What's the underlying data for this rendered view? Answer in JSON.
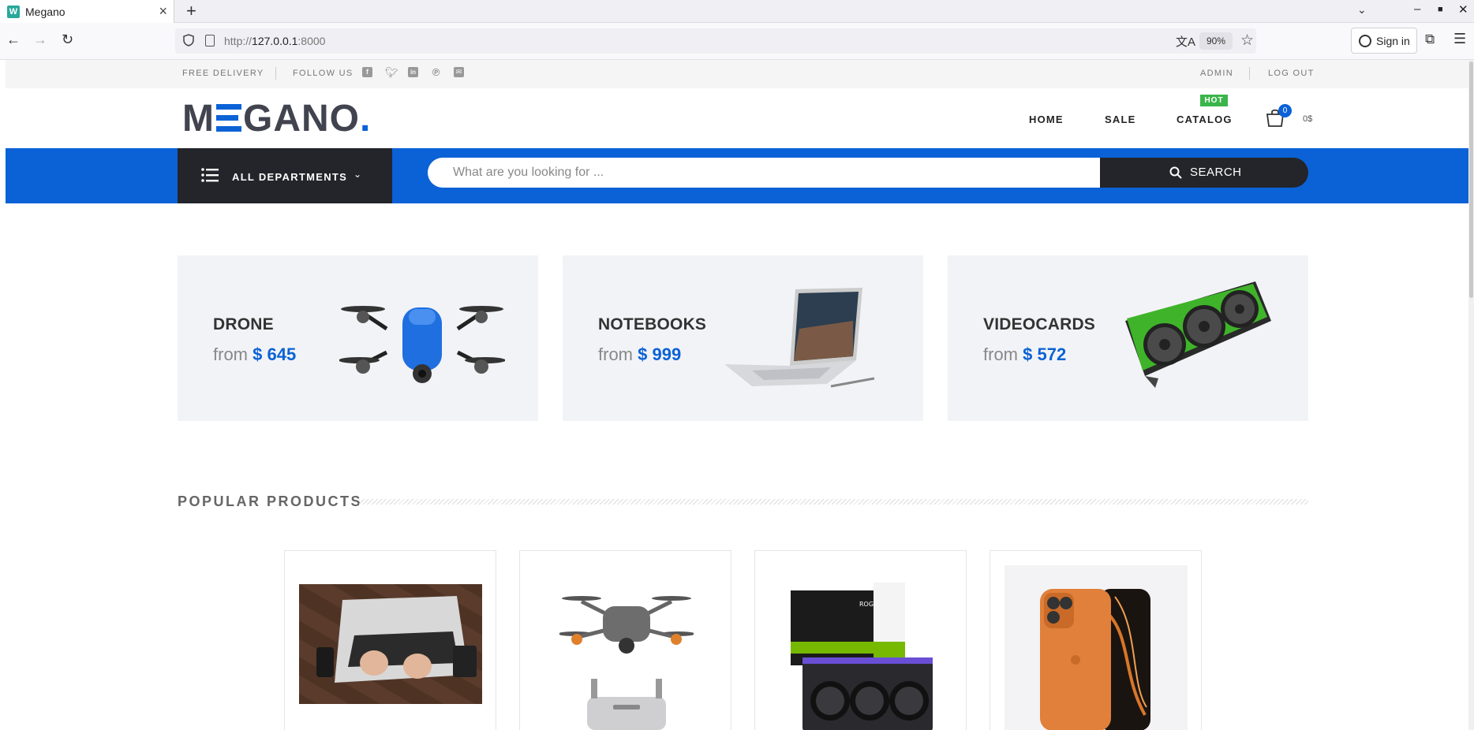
{
  "browser": {
    "tab_title": "Megano",
    "tab_favicon": "W",
    "new_tab_icon": "+",
    "url_prefix": "http://",
    "url_host": "127.0.0.1",
    "url_port": ":8000",
    "zoom": "90%",
    "sign_in_label": "Sign in"
  },
  "topbar": {
    "free_delivery": "FREE DELIVERY",
    "follow_us": "FOLLOW US",
    "social_icons": [
      "facebook-icon",
      "twitter-icon",
      "linkedin-icon",
      "pinterest-icon",
      "mail-icon"
    ],
    "admin": "ADMIN",
    "logout": "LOG OUT"
  },
  "header": {
    "logo_m": "M",
    "logo_rest": "GANO",
    "logo_dot": ".",
    "nav": [
      {
        "label": "HOME"
      },
      {
        "label": "SALE"
      },
      {
        "label": "CATALOG",
        "badge": "HOT"
      }
    ],
    "cart_count": "0",
    "cart_total": "0$"
  },
  "search": {
    "departments_label": "ALL DEPARTMENTS",
    "placeholder": "What are you looking for ...",
    "button_label": "SEARCH"
  },
  "banners": [
    {
      "title": "DRONE",
      "from": "from",
      "price": "$ 645",
      "icon": "drone-image"
    },
    {
      "title": "NOTEBOOKS",
      "from": "from",
      "price": "$ 999",
      "icon": "laptop-image"
    },
    {
      "title": "VIDEOCARDS",
      "from": "from",
      "price": "$ 572",
      "icon": "videocard-image"
    }
  ],
  "popular": {
    "title": "POPULAR PRODUCTS",
    "products": [
      {
        "image": "laptop-typing-photo"
      },
      {
        "image": "drone-with-remote-photo"
      },
      {
        "image": "rog-astral-5090-photo"
      },
      {
        "image": "orange-smartphone-photo"
      }
    ]
  },
  "colors": {
    "brand_blue": "#0b62d6",
    "dark": "#23252b",
    "hot_green": "#3ab54a",
    "banner_bg": "#f2f3f7"
  }
}
